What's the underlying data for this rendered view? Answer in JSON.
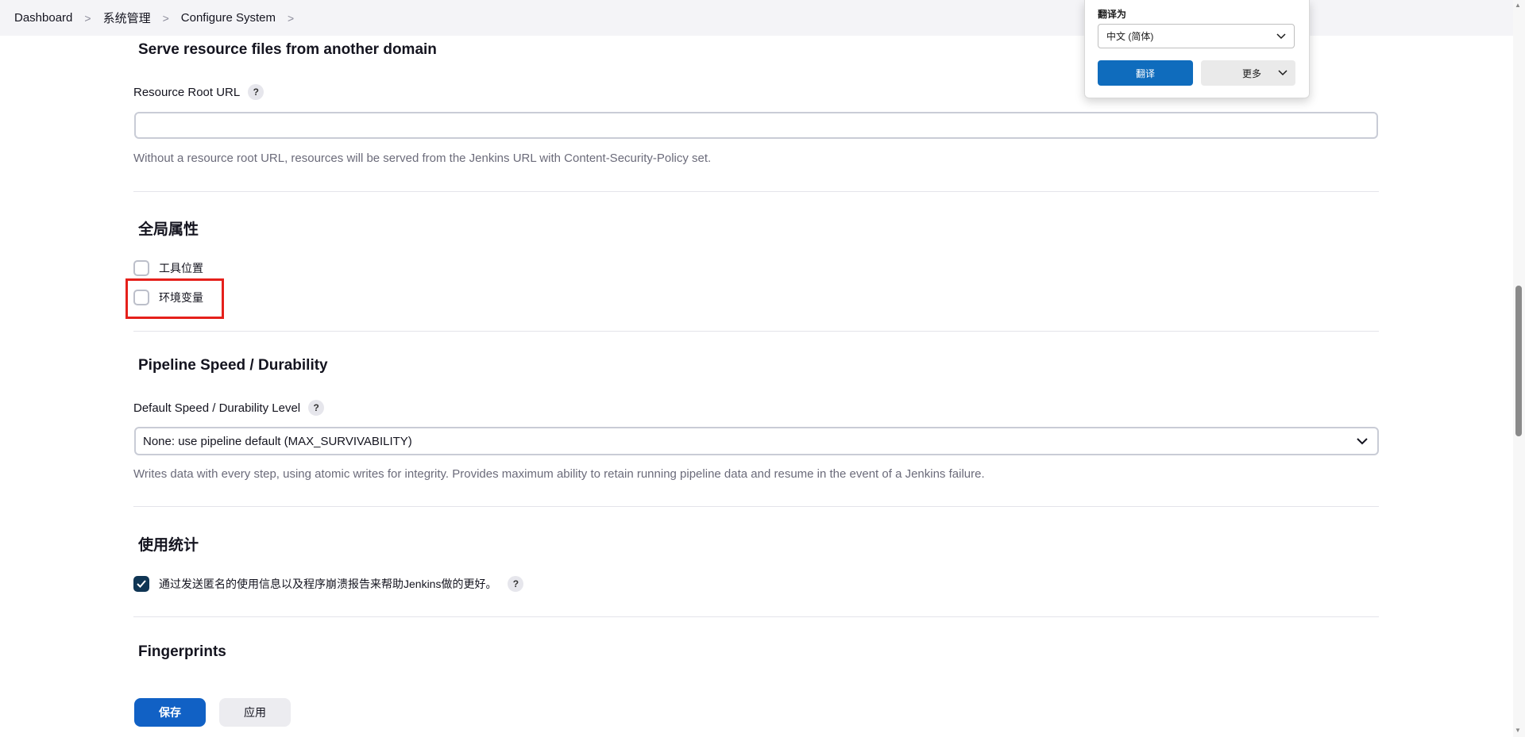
{
  "breadcrumb": {
    "items": [
      "Dashboard",
      "系统管理",
      "Configure System"
    ],
    "separator": ">"
  },
  "resource_section": {
    "title": "Serve resource files from another domain",
    "field_label": "Resource Root URL",
    "input_value": "",
    "description": "Without a resource root URL, resources will be served from the Jenkins URL with Content-Security-Policy set."
  },
  "global_props": {
    "title": "全局属性",
    "tool_locations": {
      "label": "工具位置",
      "checked": false
    },
    "env_vars": {
      "label": "环境变量",
      "checked": false
    }
  },
  "pipeline": {
    "title": "Pipeline Speed / Durability",
    "field_label": "Default Speed / Durability Level",
    "selected": "None: use pipeline default (MAX_SURVIVABILITY)",
    "description": "Writes data with every step, using atomic writes for integrity.  Provides maximum ability to retain running pipeline data and resume in the event of a Jenkins failure."
  },
  "usage": {
    "title": "使用统计",
    "checkbox_label": "通过发送匿名的使用信息以及程序崩溃报告来帮助Jenkins做的更好。",
    "checked": true
  },
  "fingerprints": {
    "title": "Fingerprints"
  },
  "footer": {
    "save_label": "保存",
    "apply_label": "应用"
  },
  "translate_popup": {
    "label": "翻译为",
    "language": "中文 (简体)",
    "translate_button": "翻译",
    "more_button": "更多"
  },
  "help_glyph": "?",
  "colors": {
    "primary_button": "#1161c5",
    "highlight_box": "#e5201b",
    "checkbox_checked": "#0f3554",
    "translate_button": "#0f6cbd"
  }
}
